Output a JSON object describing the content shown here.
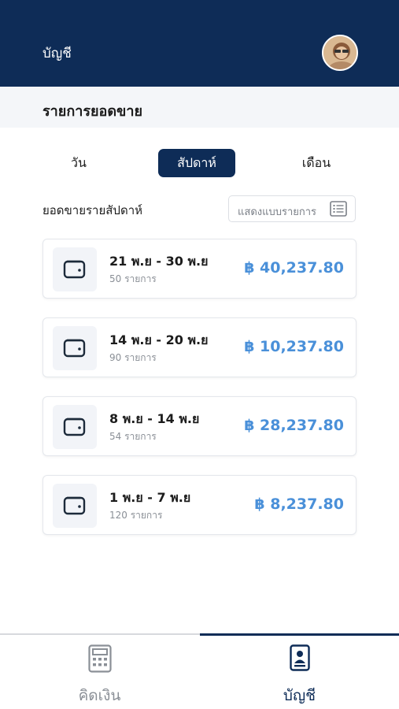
{
  "header": {
    "title": "บัญชี"
  },
  "subheader": {
    "title": "รายการยอดขาย"
  },
  "tabs": [
    {
      "label": "วัน",
      "active": false
    },
    {
      "label": "สัปดาห์",
      "active": true
    },
    {
      "label": "เดือน",
      "active": false
    }
  ],
  "section": {
    "label": "ยอดขายรายสัปดาห์",
    "view_toggle_label": "แสดงแบบรายการ"
  },
  "cards": [
    {
      "range": "21 พ.ย - 30 พ.ย",
      "count": "50 รายการ",
      "amount": "฿ 40,237.80"
    },
    {
      "range": "14 พ.ย - 20 พ.ย",
      "count": "90 รายการ",
      "amount": "฿ 10,237.80"
    },
    {
      "range": "8 พ.ย - 14 พ.ย",
      "count": "54 รายการ",
      "amount": "฿ 28,237.80"
    },
    {
      "range": "1 พ.ย - 7 พ.ย",
      "count": "120 รายการ",
      "amount": "฿ 8,237.80"
    }
  ],
  "bottom_nav": {
    "items": [
      {
        "label": "คิดเงิน",
        "icon": "calculator-icon",
        "active": false
      },
      {
        "label": "บัญชี",
        "icon": "id-card-icon",
        "active": true
      }
    ]
  },
  "colors": {
    "primary": "#0e2c57",
    "amount": "#4a90d9",
    "muted": "#8a8f96"
  }
}
